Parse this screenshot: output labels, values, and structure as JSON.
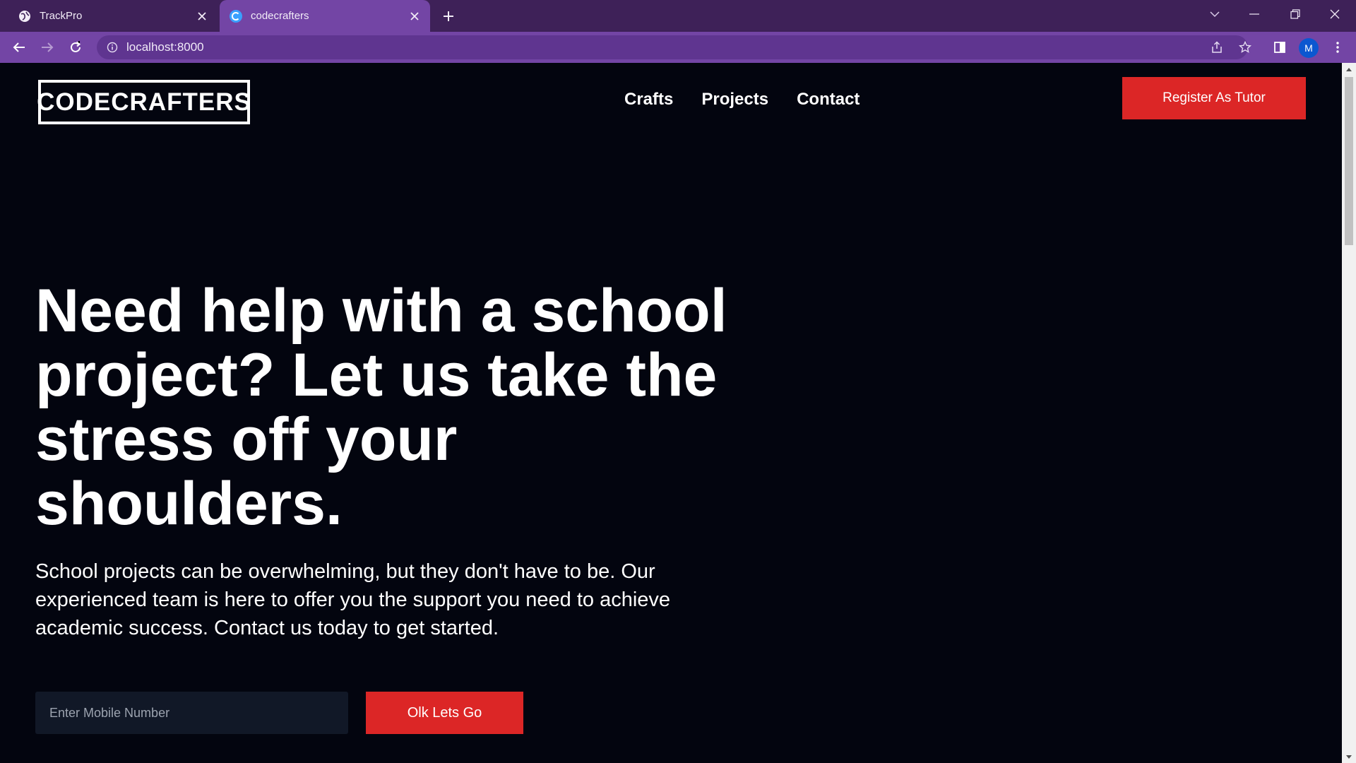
{
  "browser": {
    "tabs": [
      {
        "title": "TrackPro",
        "active": false,
        "favicon": "globe-icon"
      },
      {
        "title": "codecrafters",
        "active": true,
        "favicon": "c-logo-icon"
      }
    ],
    "url": "localhost:8000",
    "profile_initial": "M"
  },
  "site": {
    "logo": "CODECRAFTERS",
    "nav": [
      "Crafts",
      "Projects",
      "Contact"
    ],
    "register_label": "Register As Tutor"
  },
  "hero": {
    "title": "Need help with a school project? Let us take the stress off your shoulders.",
    "subtitle": "School projects can be overwhelming, but they don't have to be. Our experienced team is here to offer you the support you need to achieve academic success. Contact us today to get started.",
    "input_placeholder": "Enter Mobile Number",
    "cta_label": "Olk Lets Go"
  },
  "colors": {
    "accent": "#dc2626",
    "background": "#03050f",
    "chrome": "#7345a5"
  }
}
